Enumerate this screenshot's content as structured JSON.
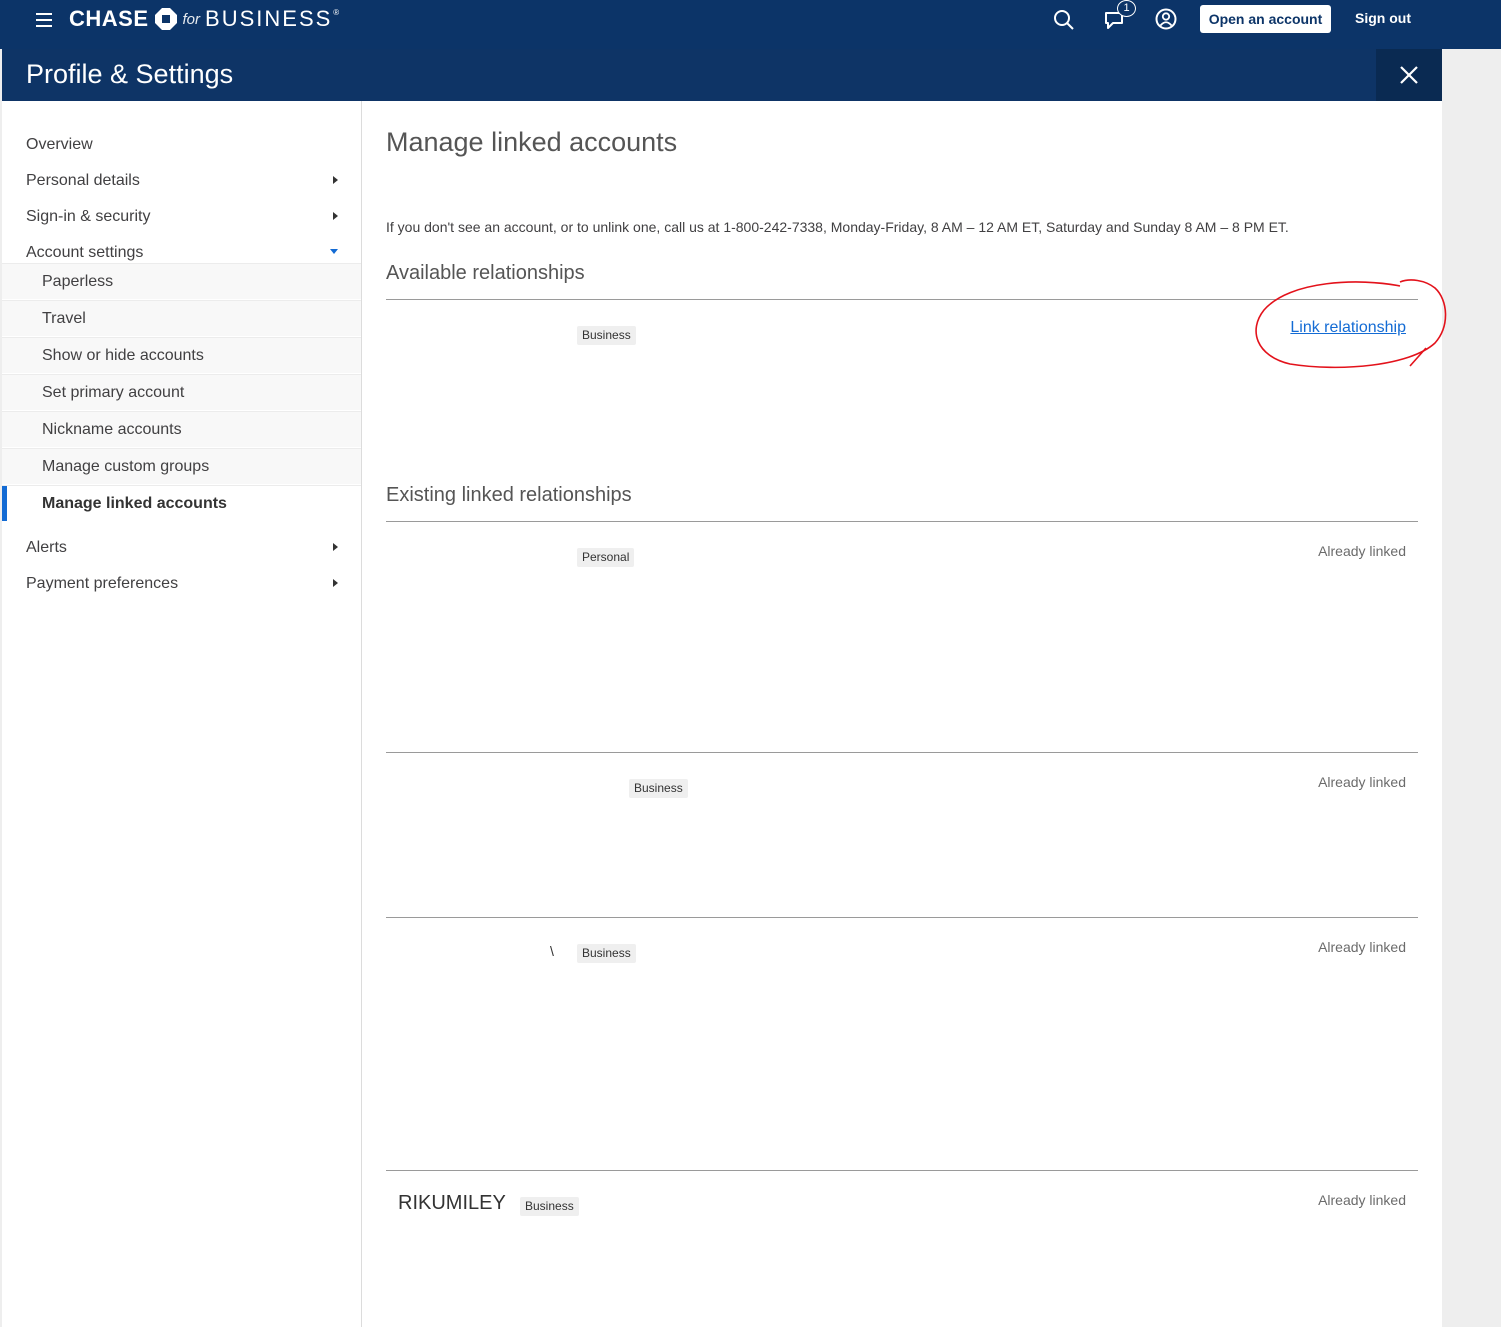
{
  "header": {
    "brand_chase": "CHASE",
    "brand_for": "for",
    "brand_business": "BUSINESS",
    "brand_reg": "®",
    "notification_count": "1",
    "open_account_label": "Open an account",
    "sign_out_label": "Sign out",
    "icons": [
      "menu-icon",
      "chase-octagon-logo",
      "search-icon",
      "notifications-icon",
      "profile-icon",
      "close-icon"
    ]
  },
  "titlebar": {
    "title": "Profile & Settings"
  },
  "sidebar": {
    "items": [
      {
        "label": "Overview"
      },
      {
        "label": "Personal details"
      },
      {
        "label": "Sign-in & security"
      },
      {
        "label": "Account settings"
      },
      {
        "label": "Alerts"
      },
      {
        "label": "Payment preferences"
      }
    ],
    "subitems": [
      {
        "label": "Paperless"
      },
      {
        "label": "Travel"
      },
      {
        "label": "Show or hide accounts"
      },
      {
        "label": "Set primary account"
      },
      {
        "label": "Nickname accounts"
      },
      {
        "label": "Manage custom groups"
      },
      {
        "label": "Manage linked accounts"
      }
    ]
  },
  "main": {
    "title": "Manage linked accounts",
    "info": "If you don't see an account, or to unlink one, call us at 1-800-242-7338, Monday-Friday, 8 AM – 12 AM ET, Saturday and Sunday 8 AM – 8 PM ET.",
    "available": {
      "heading": "Available relationships",
      "rows": [
        {
          "tag": "Business",
          "action": "Link relationship"
        }
      ]
    },
    "existing": {
      "heading": "Existing linked relationships",
      "rows": [
        {
          "name": "",
          "tag": "Personal",
          "status": "Already linked"
        },
        {
          "name": "",
          "tag": "Business",
          "status": "Already linked"
        },
        {
          "name": "",
          "glyph": "\\",
          "tag": "Business",
          "status": "Already linked"
        },
        {
          "name": "RIKUMILEY",
          "tag": "Business",
          "status": "Already linked"
        }
      ]
    }
  },
  "colors": {
    "header_bg": "#0c3468",
    "accent": "#136bd4",
    "annotation": "#e3121b"
  }
}
